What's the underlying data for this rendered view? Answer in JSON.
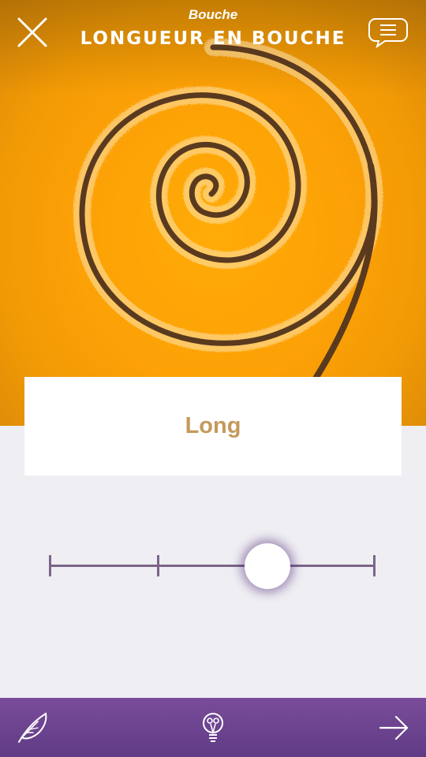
{
  "header": {
    "subtitle": "Bouche",
    "title": "Longueur en bouche"
  },
  "icons": {
    "close": "close-icon",
    "menu": "menu-icon",
    "notes": "feather-icon",
    "hint": "lightbulb-icon",
    "next": "arrow-right-icon"
  },
  "card": {
    "value_label": "Long"
  },
  "slider": {
    "steps": 4,
    "selected_index": 2,
    "value_fraction": 0.67
  },
  "colors": {
    "hero_orange": "#fca106",
    "label_gold": "#c39a5c",
    "track_purple": "#7b6588",
    "bottom_bar_purple": "#6b4390",
    "background": "#efeef3"
  }
}
